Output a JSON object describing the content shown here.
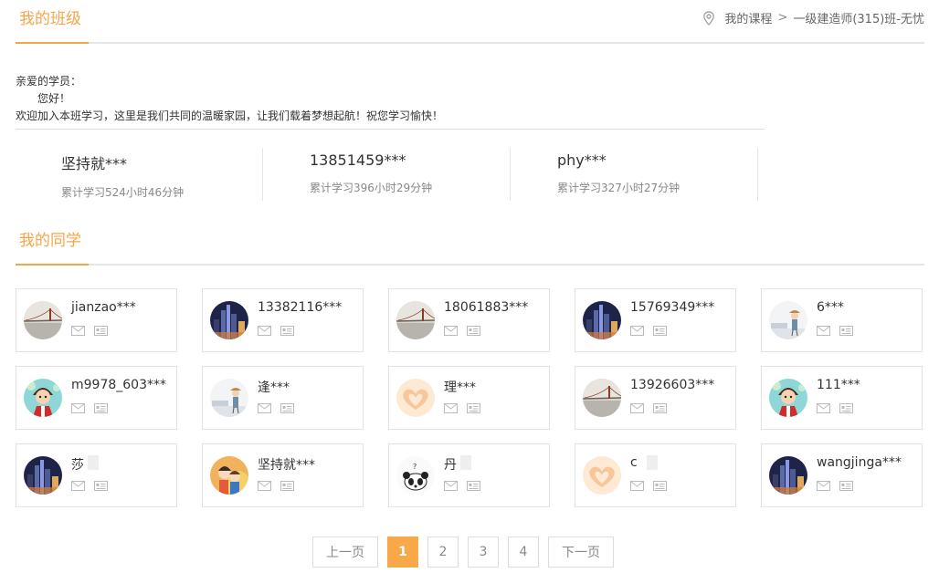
{
  "header": {
    "title": "我的班级",
    "breadcrumb": {
      "item1": "我的课程",
      "sep": ">",
      "item2": "一级建造师(315)班-无忧"
    }
  },
  "welcome": {
    "line1": "亲爱的学员：",
    "line2": "您好！",
    "line3": "欢迎加入本班学习，这里是我们共同的温暖家园，让我们载着梦想起航！祝您学习愉快！"
  },
  "stats": [
    {
      "name": "坚持就***",
      "time": "累计学习524小时46分钟"
    },
    {
      "name": "13851459***",
      "time": "累计学习396小时29分钟"
    },
    {
      "name": "phy***",
      "time": "累计学习327小时27分钟"
    }
  ],
  "classmates_section": {
    "title": "我的同学"
  },
  "classmates": [
    {
      "name": "jianzao***",
      "avatar": "bridge"
    },
    {
      "name": "13382116***",
      "avatar": "city-night"
    },
    {
      "name": "18061883***",
      "avatar": "bridge"
    },
    {
      "name": "15769349***",
      "avatar": "city-night"
    },
    {
      "name": "6***",
      "avatar": "girl-sketch"
    },
    {
      "name": "m9978_603***",
      "avatar": "cartoon-boy"
    },
    {
      "name": "逢***",
      "avatar": "girl-sketch"
    },
    {
      "name": "理***",
      "avatar": "heart-hands"
    },
    {
      "name": "13926603***",
      "avatar": "bridge"
    },
    {
      "name": "111***",
      "avatar": "cartoon-boy"
    },
    {
      "name": "莎",
      "avatar": "city-night",
      "blurred": true
    },
    {
      "name": "坚持就***",
      "avatar": "cartoon-couple"
    },
    {
      "name": "丹",
      "avatar": "panda",
      "blurred": true
    },
    {
      "name": "c",
      "avatar": "heart-hands",
      "blurred": true
    },
    {
      "name": "wangjinga***",
      "avatar": "city-night"
    }
  ],
  "pagination": {
    "prev": "上一页",
    "pages": [
      "1",
      "2",
      "3",
      "4"
    ],
    "active": "1",
    "next": "下一页"
  },
  "colors": {
    "accent": "#f5a548",
    "border": "#e3e3e3",
    "muted": "#888888"
  }
}
